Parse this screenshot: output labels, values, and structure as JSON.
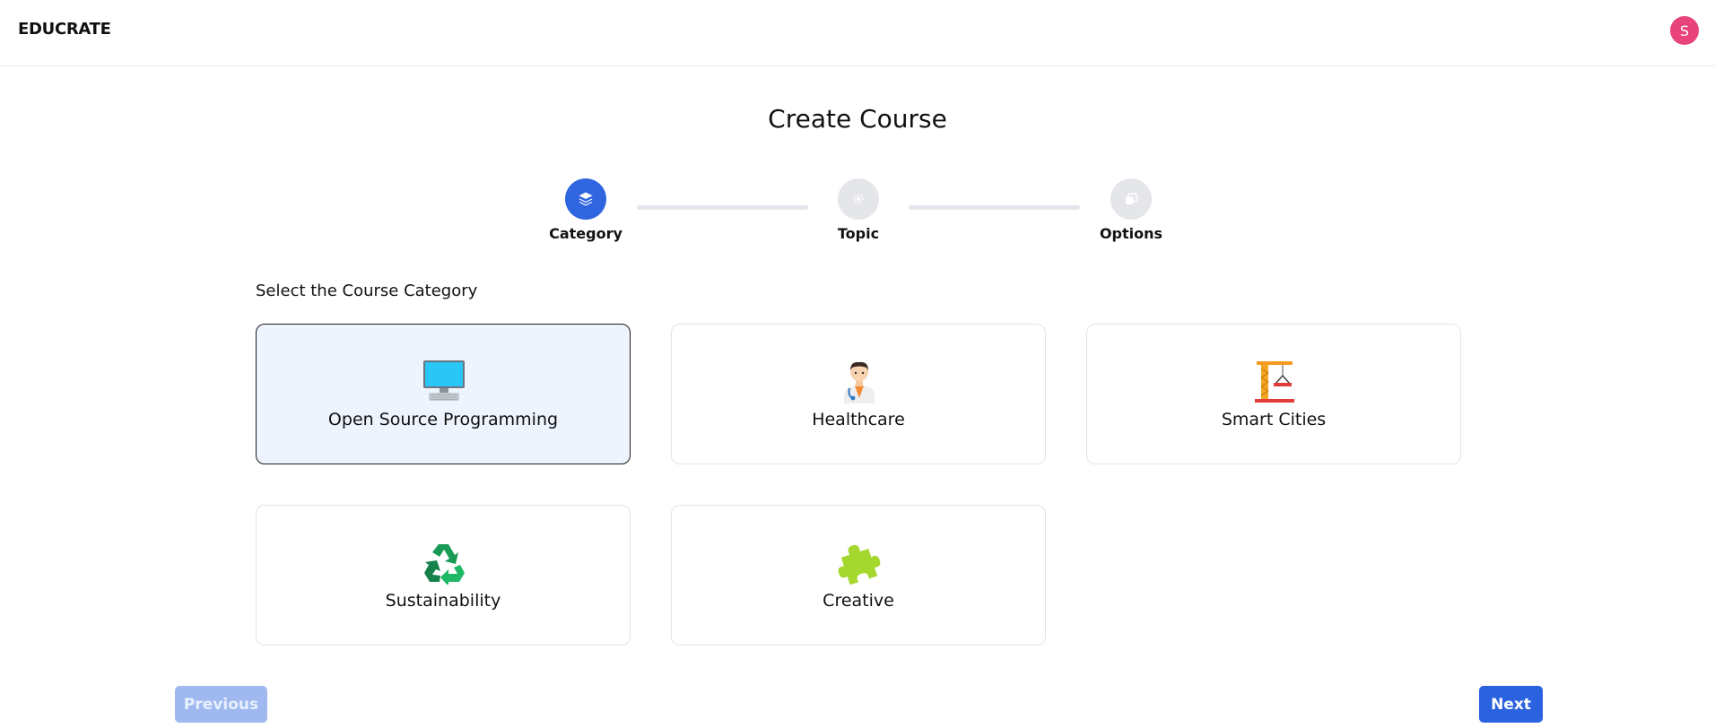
{
  "header": {
    "logo": "EDUCRATE",
    "avatar_initial": "S"
  },
  "page": {
    "title": "Create Course"
  },
  "stepper": {
    "steps": [
      {
        "label": "Category",
        "icon": "layers-icon",
        "active": true
      },
      {
        "label": "Topic",
        "icon": "lightbulb-icon",
        "active": false
      },
      {
        "label": "Options",
        "icon": "copy-icon",
        "active": false
      }
    ]
  },
  "categories": {
    "heading": "Select the Course Category",
    "selected": "Open Source Programming",
    "items": [
      {
        "label": "Open Source Programming",
        "icon": "desktop-computer-icon"
      },
      {
        "label": "Healthcare",
        "icon": "doctor-icon"
      },
      {
        "label": "Smart Cities",
        "icon": "construction-crane-icon"
      },
      {
        "label": "Sustainability",
        "icon": "recycle-icon"
      },
      {
        "label": "Creative",
        "icon": "puzzle-piece-icon"
      }
    ]
  },
  "footer": {
    "previous_label": "Previous",
    "next_label": "Next"
  },
  "colors": {
    "primary": "#2a62df",
    "primary_disabled": "#9fb9f0",
    "avatar": "#e8437a",
    "selected_card_bg": "#eef4fe"
  }
}
